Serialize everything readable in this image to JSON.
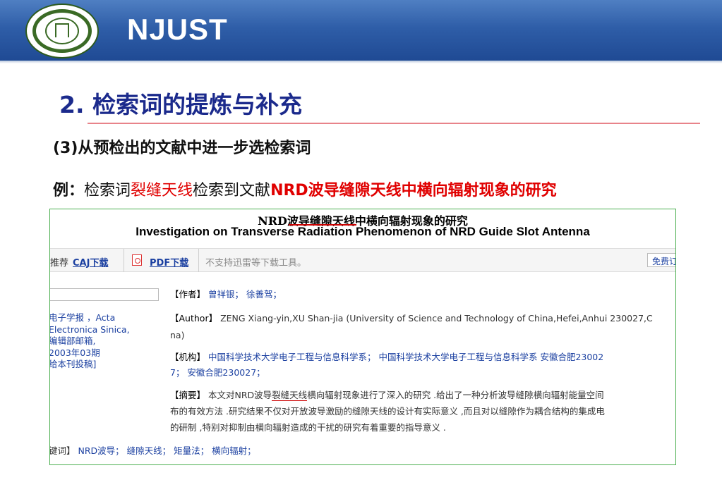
{
  "header": {
    "brand": "NJUST",
    "logo_icon": "university-seal-logo"
  },
  "slide": {
    "heading": "2. 检索词的提炼与补充",
    "subheading": "(3)从预检出的文献中进一步选检索词",
    "example": {
      "label": "例：",
      "text1": "检索词",
      "keyword": "裂缝天线",
      "text2": "检索到文献",
      "paper_title": "NRD波导缝隙天线中横向辐射现象的研究"
    }
  },
  "paper": {
    "title_cn": "NRD波导缝隙天线中横向辐射现象的研究",
    "title_en": "Investigation on Transverse Radiation Phenomenon of NRD Guide Slot Antenna",
    "downloads": {
      "recommend_prefix": "推荐",
      "caj": "CAJ下载",
      "pdf": "PDF下载",
      "note": "不支持迅雷等下载工具。",
      "free": "免费订"
    },
    "source_lines": [
      "电子学报 ，Acta",
      "Electronica Sinica,",
      "编辑部邮箱,",
      "2003年03期",
      "给本刊投稿]"
    ],
    "author_label": "【作者】",
    "authors": "曾祥银； 徐善驾；",
    "author_en_label": "【Author】",
    "author_en_line1": "ZENG Xiang-yin,XU Shan-jia (University of Science and Technology of China,Hefei,Anhui 230027,C",
    "author_en_line2": "na)",
    "org_label": "【机构】",
    "org_line1": "中国科学技术大学电子工程与信息科学系； 中国科学技术大学电子工程与信息科学系 安徽合肥23002",
    "org_line2": "7； 安徽合肥230027；",
    "abstract_label": "【摘要】",
    "abstract_line1_a": "本文对NRD波导",
    "abstract_line1_hl": "裂缝天线",
    "abstract_line1_b": "横向辐射现象进行了深入的研究 .给出了一种分析波导缝隙横向辐射能量空间",
    "abstract_line2": "布的有效方法 .研究结果不仅对开放波导激励的缝隙天线的设计有实际意义 ,而且对以缝隙作为耦合结构的集成电",
    "abstract_line3": "的研制 ,特别对抑制由横向辐射造成的干扰的研究有着重要的指导意义 .",
    "keywords_label": "键词】",
    "keywords": "NRD波导； 缝隙天线； 矩量法； 横向辐射；"
  }
}
